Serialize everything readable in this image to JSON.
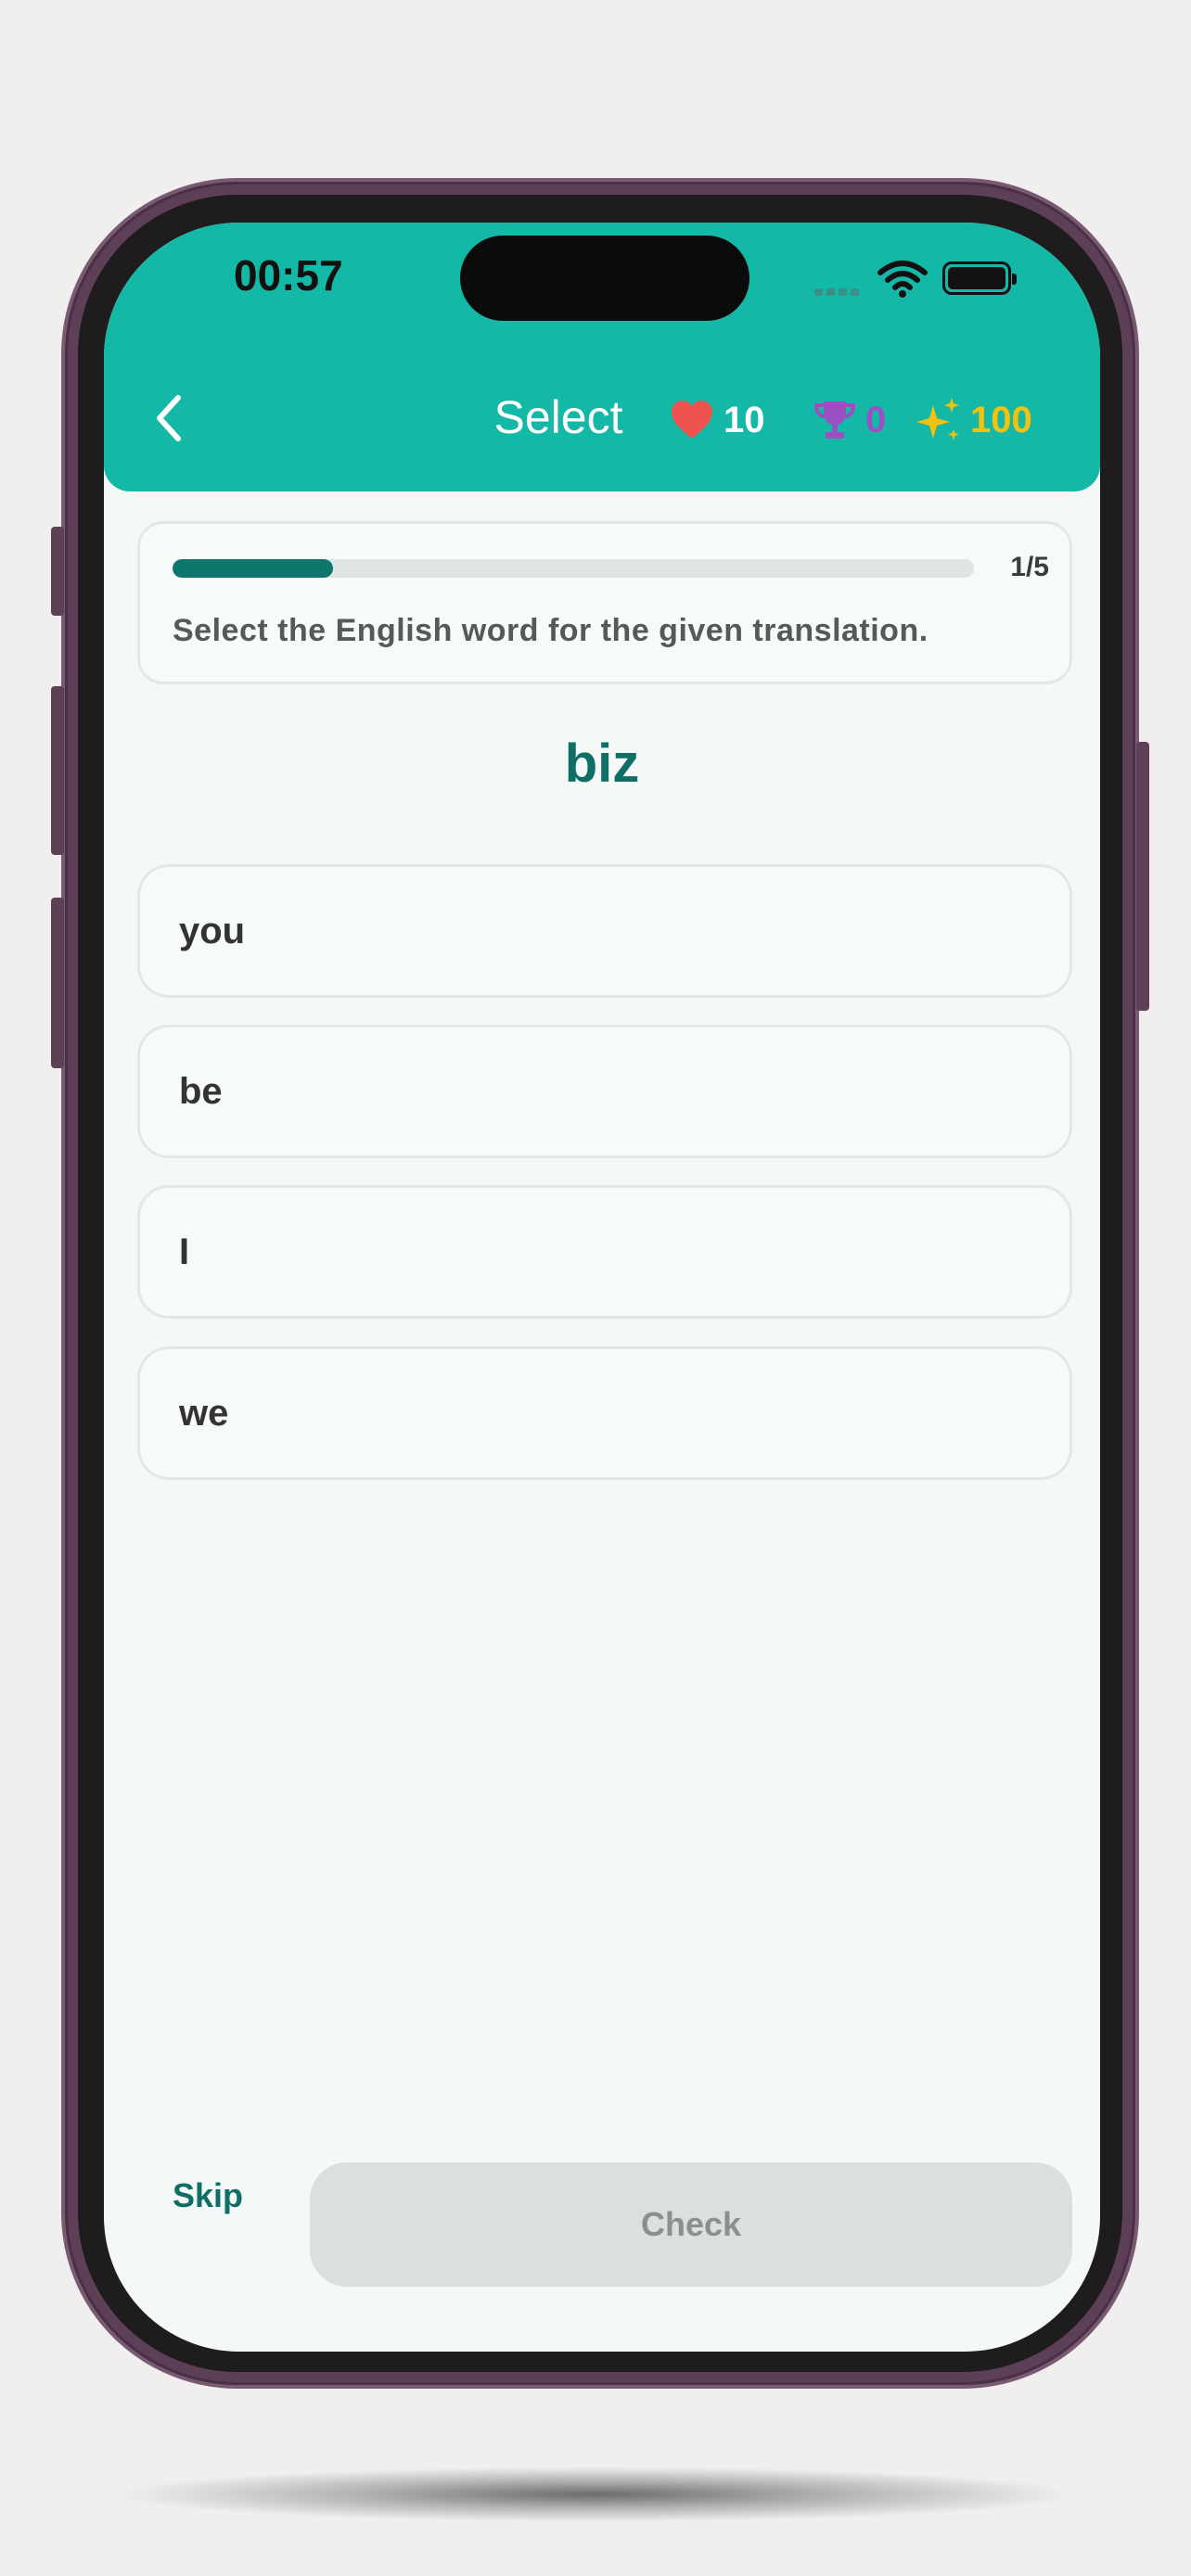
{
  "status_bar": {
    "time": "00:57",
    "icons": [
      "cellular-signal-icon",
      "wifi-icon",
      "battery-icon"
    ]
  },
  "header": {
    "back_icon": "chevron-left-icon",
    "title": "Select",
    "stats": {
      "hearts": {
        "icon": "heart-icon",
        "value": "10",
        "color": "#ef5350"
      },
      "trophies": {
        "icon": "trophy-icon",
        "value": "0",
        "color": "#9b4fc2"
      },
      "xp": {
        "icon": "sparkles-icon",
        "value": "100",
        "color": "#f4c20d"
      }
    },
    "background": "#14b8a6"
  },
  "exercise": {
    "progress_text": "1/5",
    "progress_fraction": 0.2,
    "instruction": "Select the English word for the given translation.",
    "prompt_word": "biz",
    "options": [
      "you",
      "be",
      "I",
      "we"
    ]
  },
  "footer": {
    "skip_label": "Skip",
    "check_label": "Check"
  },
  "colors": {
    "accent": "#0f6e66",
    "progress_fill": "#0f766e",
    "screen_bg": "#f4f9f8",
    "disabled_button": "#dbe0df"
  }
}
